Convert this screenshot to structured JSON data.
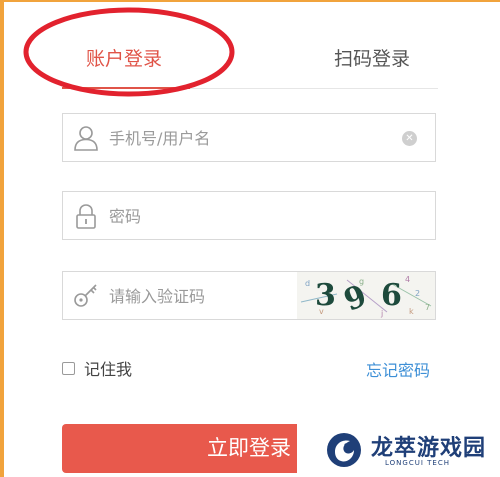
{
  "tabs": {
    "account_login": "账户登录",
    "qr_login": "扫码登录"
  },
  "form": {
    "username_placeholder": "手机号/用户名",
    "password_placeholder": "密码",
    "captcha_placeholder": "请输入验证码",
    "captcha_digits": [
      "3",
      "9",
      "6"
    ],
    "remember_label": "记住我",
    "remember_checked": false,
    "forgot_label": "忘记密码",
    "submit_label": "立即登录"
  },
  "watermark": {
    "name": "龙萃游戏园",
    "sub": "LONGCUI TECH"
  },
  "colors": {
    "accent": "#e05448",
    "button": "#e8594c",
    "link": "#3d8fd6",
    "frame": "#f1a33c",
    "annotation": "#e2222e"
  },
  "icons": {
    "username": "user-icon",
    "password": "lock-icon",
    "captcha": "key-icon",
    "clear": "clear-icon",
    "watermark": "dragon-logo-icon"
  }
}
